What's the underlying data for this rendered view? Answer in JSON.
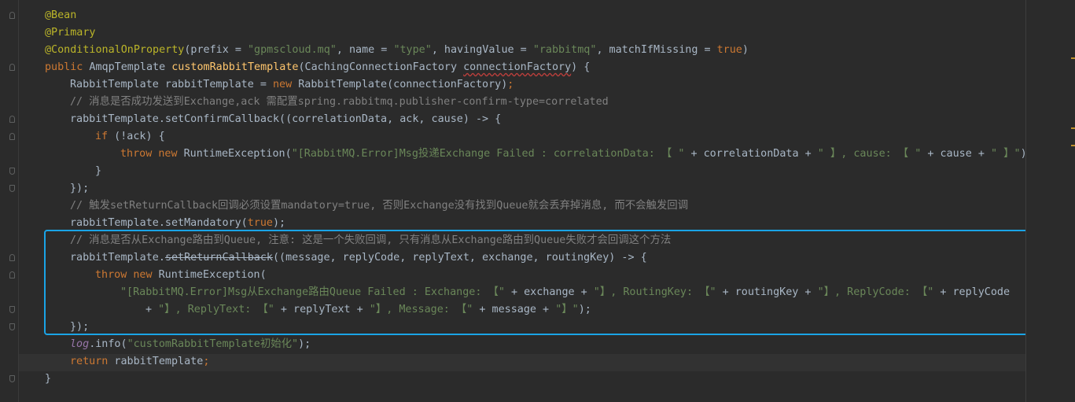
{
  "code": {
    "ann_bean": "@Bean",
    "ann_primary": "@Primary",
    "ann_cond": "@ConditionalOnProperty",
    "l3_a": "(prefix = ",
    "l3_prefix": "\"gpmscloud.mq\"",
    "l3_b": ", name = ",
    "l3_name": "\"type\"",
    "l3_c": ", havingValue = ",
    "l3_hv": "\"rabbitmq\"",
    "l3_d": ", matchIfMissing = ",
    "l3_true": "true",
    "l3_e": ")",
    "kw_public": "public",
    "l4_type": " AmqpTemplate ",
    "l4_method": "customRabbitTemplate",
    "l4_a": "(CachingConnectionFactory ",
    "l4_param": "connectionFactory",
    "l4_b": ") {",
    "l5_a": "RabbitTemplate rabbitTemplate = ",
    "kw_new": "new",
    "l5_b": " RabbitTemplate(connectionFactory)",
    "semi": ";",
    "comment1": "// 消息是否成功发送到Exchange,ack 需配置spring.rabbitmq.publisher-confirm-type=correlated",
    "l7": "rabbitTemplate.setConfirmCallback((correlationData, ack, cause) -> {",
    "kw_if": "if",
    "l8_a": " (!ack) {",
    "kw_throw": "throw",
    "l9_a": " RuntimeException(",
    "l9_s1": "\"[RabbitMQ.Error]Msg投递Exchange Failed : correlationData: 【 \"",
    "l9_b": " + correlationData + ",
    "l9_s2": "\" 】, cause: 【 \"",
    "l9_c": " + cause + ",
    "l9_s3": "\" 】\"",
    "l9_d": ");",
    "brace_close": "}",
    "close_paren": "});",
    "comment2": "// 触发setReturnCallback回调必须设置mandatory=true, 否则Exchange没有找到Queue就会丢弃掉消息, 而不会触发回调",
    "l13_a": "rabbitTemplate.setMandatory(",
    "l13_true": "true",
    "l13_b": ");",
    "comment3": "// 消息是否从Exchange路由到Queue, 注意: 这是一个失败回调, 只有消息从Exchange路由到Queue失败才会回调这个方法",
    "l15_a": "rabbitTemplate.",
    "l15_depr": "setReturnCallback",
    "l15_b": "((message, replyCode, replyText, exchange, routingKey) -> {",
    "l16_a": " RuntimeException(",
    "l17_s1": "\"[RabbitMQ.Error]Msg从Exchange路由Queue Failed : Exchange: 【\"",
    "l17_b": " + exchange + ",
    "l17_s2": "\"】, RoutingKey: 【\"",
    "l17_c": " + routingKey + ",
    "l17_s3": "\"】, ReplyCode: 【\"",
    "l17_d": " + replyCode",
    "l18_a": "+ ",
    "l18_s1": "\"】, ReplyText: 【\"",
    "l18_b": " + replyText + ",
    "l18_s2": "\"】, Message: 【\"",
    "l18_c": " + message + ",
    "l18_s3": "\"】\"",
    "l18_d": ");",
    "l20_log": "log",
    "l20_a": ".info(",
    "l20_s": "\"customRabbitTemplate初始化\"",
    "l20_b": ");",
    "kw_return": "return",
    "l21_a": " rabbitTemplate",
    "l22": "}"
  },
  "colors": {
    "background": "#2b2b2b",
    "keyword": "#cc7832",
    "annotation": "#bbb529",
    "string": "#6a8759",
    "comment": "#808080",
    "method": "#ffc66d",
    "highlight_border": "#1aa4e6"
  }
}
